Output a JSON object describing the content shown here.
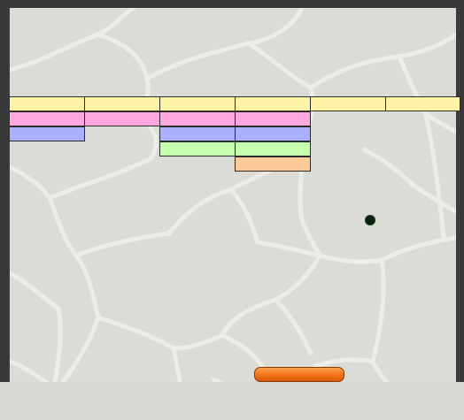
{
  "game": {
    "title": "",
    "colors": {
      "frame": "#3a3a3a",
      "background": "#dcdcd7",
      "paddle": "#f07418",
      "ball": "#0a1e0f"
    },
    "brick_colors": {
      "yellow": "#fff3a6",
      "pink": "#ffa8e0",
      "blue": "#aab0ff",
      "green": "#c6ffae",
      "orange": "#ffc99a"
    },
    "brick_rows": [
      [
        "yellow",
        "yellow",
        "yellow",
        "yellow",
        "yellow",
        "yellow"
      ],
      [
        "pink",
        "pink",
        "pink",
        "pink",
        null,
        null
      ],
      [
        "blue",
        null,
        "blue",
        "blue",
        null,
        null
      ],
      [
        null,
        null,
        "green",
        "green",
        null,
        null
      ],
      [
        null,
        null,
        null,
        "orange",
        null,
        null
      ]
    ]
  }
}
